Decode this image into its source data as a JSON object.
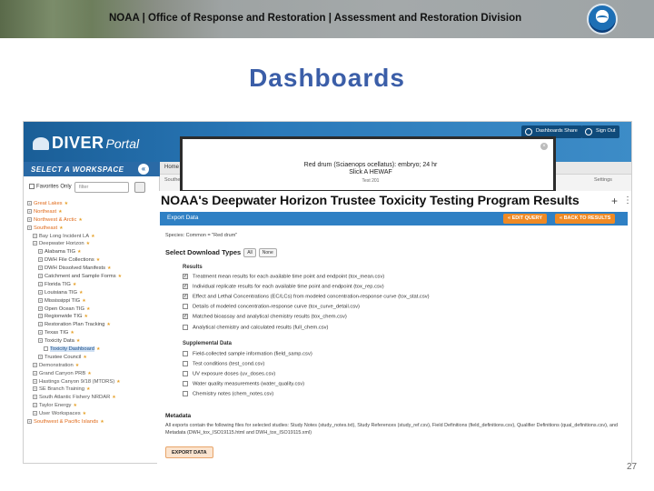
{
  "banner": {
    "title": "NOAA | Office of Response and Restoration | Assessment and Restoration Division"
  },
  "slide": {
    "title": "Dashboards",
    "page_number": "27"
  },
  "app": {
    "logo_word": "DIVER",
    "logo_suffix": "Portal",
    "header_buttons": [
      "Dashboards Share",
      "Sign Out"
    ],
    "workspace_label": "SELECT A WORKSPACE",
    "favorites_label": "Favorites Only",
    "filter_placeholder": "filter",
    "crumb": "Home",
    "sub_crumb": "Southea",
    "settings_link": "Settings",
    "tree": [
      {
        "label": "Great Lakes",
        "level": 1,
        "star": true
      },
      {
        "label": "Northeast",
        "level": 1,
        "star": true
      },
      {
        "label": "Northwest & Arctic",
        "level": 1,
        "star": true
      },
      {
        "label": "Southeast",
        "level": 1,
        "star": true
      },
      {
        "label": "Bay Long Incident LA",
        "level": 2,
        "star": true
      },
      {
        "label": "Deepwater Horizon",
        "level": 2,
        "star": true
      },
      {
        "label": "Alabama TIG",
        "level": 3,
        "star": true
      },
      {
        "label": "DWH File Collections",
        "level": 3,
        "star": true
      },
      {
        "label": "DWH Dissolved Manifests",
        "level": 3,
        "star": true
      },
      {
        "label": "Catchment and Sample Forms",
        "level": 3,
        "star": true
      },
      {
        "label": "Florida TIG",
        "level": 3,
        "star": true
      },
      {
        "label": "Louisiana TIG",
        "level": 3,
        "star": true
      },
      {
        "label": "Mississippi TIG",
        "level": 3,
        "star": true
      },
      {
        "label": "Open Ocean TIG",
        "level": 3,
        "star": true
      },
      {
        "label": "Regionwide TIG",
        "level": 3,
        "star": true
      },
      {
        "label": "Restoration Plan Tracking",
        "level": 3,
        "star": true
      },
      {
        "label": "Texas TIG",
        "level": 3,
        "star": true
      },
      {
        "label": "Toxicity Data",
        "level": 3,
        "star": true
      },
      {
        "label": "Toxicity Dashboard",
        "level": 4,
        "star": true,
        "selected": true
      },
      {
        "label": "Trustee Council",
        "level": 3,
        "star": true
      },
      {
        "label": "Demonstration",
        "level": 2,
        "star": true
      },
      {
        "label": "Grand Canyon PRB",
        "level": 2,
        "star": true
      },
      {
        "label": "Hastings Canyon 9/18 (MTDRS)",
        "level": 2,
        "star": true
      },
      {
        "label": "SE Branch Training",
        "level": 2,
        "star": true
      },
      {
        "label": "South Atlantic Fishery NRDAR",
        "level": 2,
        "star": true
      },
      {
        "label": "Taylor Energy",
        "level": 2,
        "star": true
      },
      {
        "label": "User Workspaces",
        "level": 2,
        "star": true
      },
      {
        "label": "Southwest & Pacific Islands",
        "level": 1,
        "star": true
      }
    ]
  },
  "modal": {
    "line1": "Red drum (Sciaenops ocellatus): embryo; 24 hr",
    "line2": "Slick A HEWAF",
    "line3": "Test 201",
    "close": "×"
  },
  "panel": {
    "title": "NOAA's Deepwater Horizon Trustee Toxicity Testing Program Results",
    "plus": "+",
    "dots": "⋮",
    "bar_label": "Export Data",
    "edit_query": "« EDIT QUERY",
    "back_to_results": "« BACK TO RESULTS",
    "species_line": "Species: Common = \"Red drum\"",
    "download_heading": "Select Download Types",
    "all_btn": "All",
    "none_btn": "None",
    "results_heading": "Results",
    "results_options": [
      {
        "label": "Treatment mean results for each available time point and endpoint (tox_mean.csv)",
        "checked": true
      },
      {
        "label": "Individual replicate results for each available time point and endpoint (tox_rep.csv)",
        "checked": true
      },
      {
        "label": "Effect and Lethal Concentrations (EC/LCs) from modeled concentration-response curve (tox_stat.csv)",
        "checked": true
      },
      {
        "label": "Details of modeled concentration-response curve (tox_curve_detail.csv)",
        "checked": false
      },
      {
        "label": "Matched bioassay and analytical chemistry results (tox_chem.csv)",
        "checked": true
      },
      {
        "label": "Analytical chemistry and calculated results (full_chem.csv)",
        "checked": false
      }
    ],
    "supplemental_heading": "Supplemental Data",
    "supplemental_options": [
      {
        "label": "Field-collected sample information (field_samp.csv)",
        "checked": false
      },
      {
        "label": "Test conditions (test_cond.csv)",
        "checked": false
      },
      {
        "label": "UV exposure doses (uv_doses.csv)",
        "checked": false
      },
      {
        "label": "Water quality measurements (water_quality.csv)",
        "checked": false
      },
      {
        "label": "Chemistry notes (chem_notes.csv)",
        "checked": false
      }
    ],
    "metadata_heading": "Metadata",
    "metadata_text": "All exports contain the following files for selected studies: Study Notes (study_notes.txt), Study References (study_ref.csv), Field Definitions (field_definitions.csv), Qualifier Definitions (qual_definitions.csv), and Metadata (DWH_tox_ISO19115.html and DWH_tox_ISO19115.xml)",
    "export_button": "EXPORT DATA"
  }
}
